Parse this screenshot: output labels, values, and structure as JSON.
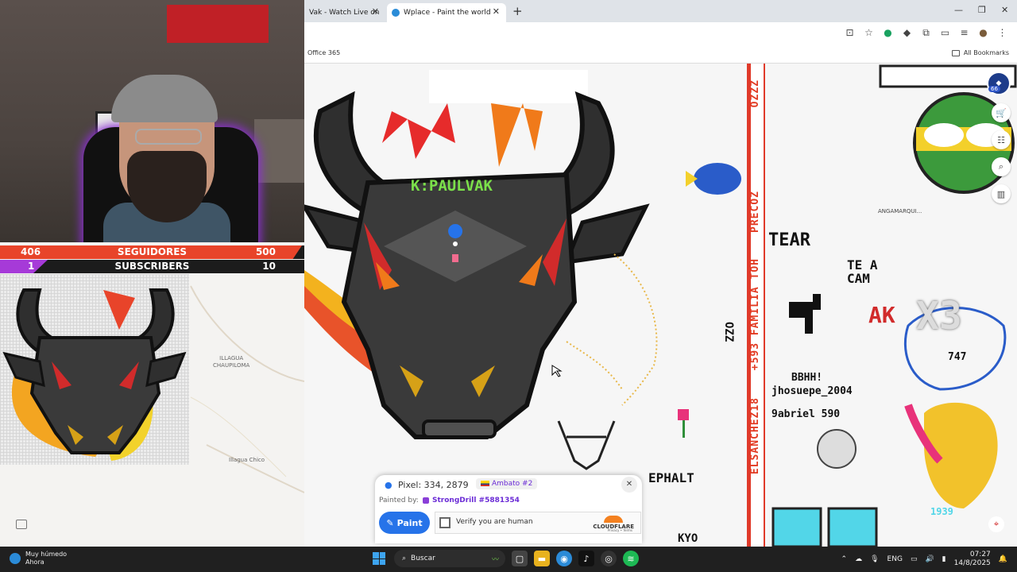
{
  "browser": {
    "tabs": [
      {
        "label": "Vak - Watch Live on",
        "active": false
      },
      {
        "label": "Wplace - Paint the world",
        "active": true
      }
    ],
    "bookmarks": {
      "left": "Office 365",
      "right": "All Bookmarks"
    }
  },
  "stream_overlay": {
    "followers": {
      "current": "406",
      "label": "SEGUIDORES",
      "goal": "500",
      "progress": 0.81
    },
    "subscribers": {
      "current": "1",
      "label": "SUBSCRIBERS",
      "goal": "10",
      "progress": 0.1
    }
  },
  "map_labels": {
    "illagua_chaupiloma": "ILLAGUA\nCHAUPILOMA",
    "illagua_chico": "Illagua Chico",
    "angamarquillo": "ANGAMARQUI..."
  },
  "canvas_text": {
    "bull_name": "K:PAULVAK",
    "precoz": "PRECOZ",
    "familia": "+593 FAMILIA TOH",
    "elsanchez": "ELSANCHEZ18",
    "ozzz": "OZZZ",
    "ozz2": "OZZ",
    "tear": "TEAR",
    "te_a_cam": "TE A\nCAM",
    "ak": "AK",
    "x3": "X3",
    "bbhh": "BBHH!",
    "jhosuepe": "jhosuepe_2004",
    "gabriel": "9abriel 590",
    "num747": "747",
    "num1939": "1939",
    "ephalt": "EPHALT",
    "kyo": "KYO"
  },
  "pixel_info": {
    "pixel_label": "Pixel: 334, 2879",
    "region": "Ambato #2",
    "painted_by_label": "Painted by:",
    "painter": "StrongDrill #5881354",
    "paint_button": "Paint",
    "captcha_label": "Verify you are human",
    "captcha_brand": "CLOUDFLARE",
    "captcha_links": "Privacy • Terms"
  },
  "toolbar": {
    "badge": "66"
  },
  "taskbar": {
    "weather_title": "Muy húmedo",
    "weather_sub": "Ahora",
    "search": "Buscar",
    "lang": "ENG",
    "time": "07:27",
    "date": "14/8/2025"
  },
  "colors": {
    "followers_fill": "#e8442a",
    "subscribers_fill": "#a63ad8",
    "paint_button": "#2673e9",
    "bull_body": "#2f2f2f",
    "bull_text": "#7be04a"
  }
}
